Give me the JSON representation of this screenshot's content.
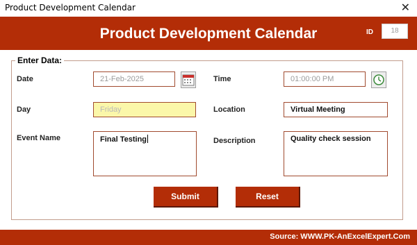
{
  "window": {
    "title": "Product Development Calendar",
    "close_glyph": "✕"
  },
  "header": {
    "heading": "Product Development Calendar",
    "id_label": "ID",
    "id_value": "18",
    "bg_color": "#b32d07"
  },
  "form": {
    "legend": "Enter Data:",
    "date": {
      "label": "Date",
      "value": "21-Feb-2025",
      "icon": "calendar-icon"
    },
    "time": {
      "label": "Time",
      "value": "01:00:00 PM",
      "icon": "clock-icon"
    },
    "day": {
      "label": "Day",
      "value": "Friday"
    },
    "location": {
      "label": "Location",
      "value": "Virtual Meeting"
    },
    "event_name": {
      "label": "Event Name",
      "value": "Final Testing"
    },
    "description": {
      "label": "Description",
      "value": "Quality check session"
    }
  },
  "buttons": {
    "submit": "Submit",
    "reset": "Reset"
  },
  "footer": {
    "source": "Source: WWW.PK-AnExcelExpert.Com"
  }
}
